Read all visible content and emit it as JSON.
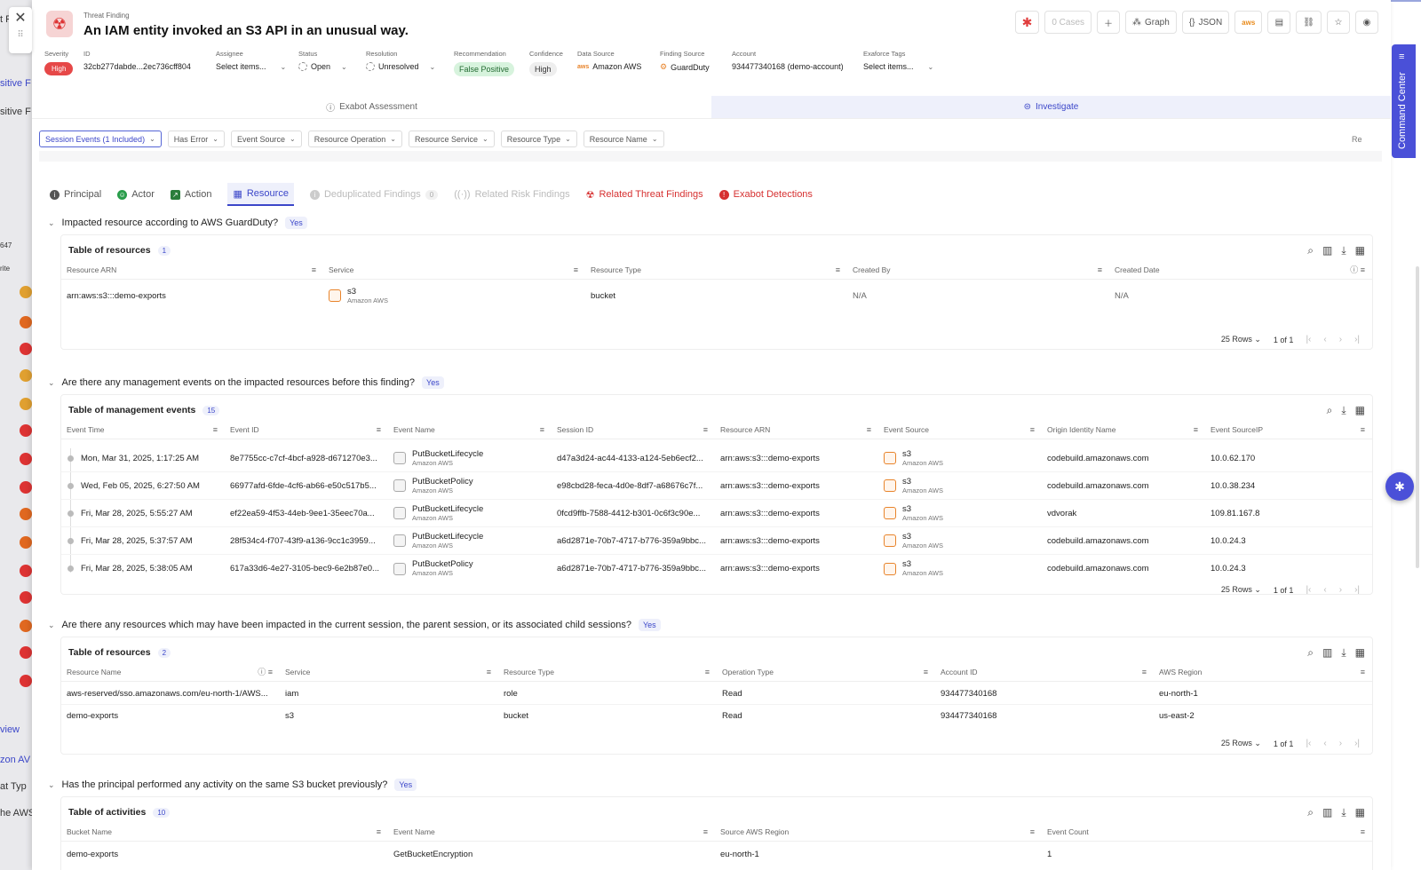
{
  "background": {
    "fragments": [
      "t F",
      "sitive F",
      "sitive F",
      "647",
      "rite",
      "view",
      "zon AV",
      "at Typ",
      "he AWS"
    ]
  },
  "header": {
    "kicker": "Threat Finding",
    "title": "An IAM entity invoked an S3 API in an unusual way.",
    "actions": {
      "cases": "0 Cases",
      "graph": "Graph",
      "json": "JSON",
      "aws": "aws"
    }
  },
  "meta": {
    "severity": {
      "label": "Severity",
      "value": "High"
    },
    "id": {
      "label": "ID",
      "value": "32cb277dabde...2ec736cff804"
    },
    "assignee": {
      "label": "Assignee",
      "value": "Select items..."
    },
    "status": {
      "label": "Status",
      "value": "Open"
    },
    "resolution": {
      "label": "Resolution",
      "value": "Unresolved"
    },
    "recommendation": {
      "label": "Recommendation",
      "value": "False Positive"
    },
    "confidence": {
      "label": "Confidence",
      "value": "High"
    },
    "data_source": {
      "label": "Data Source",
      "value": "Amazon AWS"
    },
    "finding_source": {
      "label": "Finding Source",
      "value": "GuardDuty"
    },
    "account": {
      "label": "Account",
      "value": "934477340168 (demo-account)"
    },
    "tags": {
      "label": "Exaforce Tags",
      "value": "Select items..."
    }
  },
  "main_tabs": {
    "assessment": "Exabot Assessment",
    "investigate": "Investigate"
  },
  "filters": [
    "Session Events (1 Included)",
    "Has Error",
    "Event Source",
    "Resource Operation",
    "Resource Service",
    "Resource Type",
    "Resource Name"
  ],
  "filters_overflow": "Re",
  "subtabs": {
    "principal": "Principal",
    "actor": "Actor",
    "action": "Action",
    "resource": "Resource",
    "dedup": "Deduplicated Findings",
    "dedup_count": "0",
    "related_risk": "Related Risk Findings",
    "related_threat": "Related Threat Findings",
    "exabot": "Exabot Detections"
  },
  "section1": {
    "question": "Impacted resource according to AWS GuardDuty?",
    "answer": "Yes",
    "table_title": "Table of resources",
    "count": "1",
    "headers": [
      "Resource ARN",
      "Service",
      "Resource Type",
      "Created By",
      "Created Date"
    ],
    "rows": [
      {
        "arn": "arn:aws:s3:::demo-exports",
        "service": "s3",
        "provider": "Amazon AWS",
        "type": "bucket",
        "created_by": "N/A",
        "created_date": "N/A"
      }
    ],
    "pager": {
      "rows": "25 Rows",
      "page": "1",
      "of": "of 1"
    }
  },
  "section2": {
    "question": "Are there any management events on the impacted resources before this finding?",
    "answer": "Yes",
    "table_title": "Table of management events",
    "count": "15",
    "headers": [
      "Event Time",
      "Event ID",
      "Event Name",
      "Session ID",
      "Resource ARN",
      "Event Source",
      "Origin Identity Name",
      "Event SourceIP"
    ],
    "rows": [
      {
        "time": "Mon, Mar 31, 2025, 1:17:25 AM",
        "id": "8e7755cc-c7cf-4bcf-a928-d671270e3...",
        "name": "PutBucketLifecycle",
        "provider": "Amazon AWS",
        "session": "d47a3d24-ac44-4133-a124-5eb6ecf2...",
        "arn": "arn:aws:s3:::demo-exports",
        "source": "s3",
        "origin": "codebuild.amazonaws.com",
        "ip": "10.0.62.170"
      },
      {
        "time": "Wed, Feb 05, 2025, 6:27:50 AM",
        "id": "66977afd-6fde-4cf6-ab66-e50c517b5...",
        "name": "PutBucketPolicy",
        "provider": "Amazon AWS",
        "session": "e98cbd28-feca-4d0e-8df7-a68676c7f...",
        "arn": "arn:aws:s3:::demo-exports",
        "source": "s3",
        "origin": "codebuild.amazonaws.com",
        "ip": "10.0.38.234"
      },
      {
        "time": "Fri, Mar 28, 2025, 5:55:27 AM",
        "id": "ef22ea59-4f53-44eb-9ee1-35eec70a...",
        "name": "PutBucketLifecycle",
        "provider": "Amazon AWS",
        "session": "0fcd9ffb-7588-4412-b301-0c6f3c90e...",
        "arn": "arn:aws:s3:::demo-exports",
        "source": "s3",
        "origin": "vdvorak",
        "ip": "109.81.167.8"
      },
      {
        "time": "Fri, Mar 28, 2025, 5:37:57 AM",
        "id": "28f534c4-f707-43f9-a136-9cc1c3959...",
        "name": "PutBucketLifecycle",
        "provider": "Amazon AWS",
        "session": "a6d2871e-70b7-4717-b776-359a9bbc...",
        "arn": "arn:aws:s3:::demo-exports",
        "source": "s3",
        "origin": "codebuild.amazonaws.com",
        "ip": "10.0.24.3"
      },
      {
        "time": "Fri, Mar 28, 2025, 5:38:05 AM",
        "id": "617a33d6-4e27-3105-bec9-6e2b87e0...",
        "name": "PutBucketPolicy",
        "provider": "Amazon AWS",
        "session": "a6d2871e-70b7-4717-b776-359a9bbc...",
        "arn": "arn:aws:s3:::demo-exports",
        "source": "s3",
        "origin": "codebuild.amazonaws.com",
        "ip": "10.0.24.3"
      }
    ],
    "pager": {
      "rows": "25 Rows",
      "page": "1",
      "of": "of 1"
    }
  },
  "section3": {
    "question": "Are there any resources which may have been impacted in the current session, the parent session, or its associated child sessions?",
    "answer": "Yes",
    "table_title": "Table of resources",
    "count": "2",
    "headers": [
      "Resource Name",
      "Service",
      "Resource Type",
      "Operation Type",
      "Account ID",
      "AWS Region"
    ],
    "rows": [
      {
        "name": "aws-reserved/sso.amazonaws.com/eu-north-1/AWS...",
        "service": "iam",
        "type": "role",
        "op": "Read",
        "account": "934477340168",
        "region": "eu-north-1"
      },
      {
        "name": "demo-exports",
        "service": "s3",
        "type": "bucket",
        "op": "Read",
        "account": "934477340168",
        "region": "us-east-2"
      }
    ],
    "pager": {
      "rows": "25 Rows",
      "page": "1",
      "of": "of 1"
    }
  },
  "section4": {
    "question": "Has the principal performed any activity on the same S3 bucket previously?",
    "answer": "Yes",
    "table_title": "Table of activities",
    "count": "10",
    "headers": [
      "Bucket Name",
      "Event Name",
      "Source AWS Region",
      "Event Count"
    ],
    "rows": [
      {
        "bucket": "demo-exports",
        "event": "GetBucketEncryption",
        "region": "eu-north-1",
        "count": "1"
      }
    ]
  },
  "command_center": "Command Center",
  "colors": {
    "accent": "#4a50d8",
    "danger": "#e64848",
    "aws_orange": "#e8842b"
  }
}
